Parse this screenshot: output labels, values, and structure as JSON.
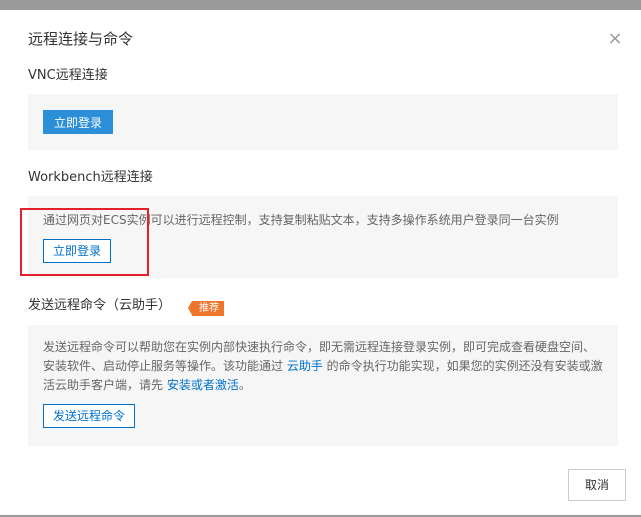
{
  "dialog": {
    "title": "远程连接与命令",
    "close_icon": "×"
  },
  "vnc": {
    "title": "VNC远程连接",
    "button_label": "立即登录"
  },
  "workbench": {
    "title": "Workbench远程连接",
    "description": "通过网页对ECS实例可以进行远程控制，支持复制粘贴文本，支持多操作系统用户登录同一台实例",
    "button_label": "立即登录"
  },
  "command": {
    "title": "发送远程命令（云助手）",
    "badge": "推荐",
    "desc_line1": "发送远程命令可以帮助您在实例内部快速执行命令，即无需远程连接登录实例，即可完成查看硬盘空间、",
    "desc_line2_a": "安装软件、启动停止服务等操作。该功能通过 ",
    "desc_line2_link": "云助手",
    "desc_line2_b": " 的命令执行功能实现，如果您的实例还没有安装或激",
    "desc_line3_a": "活云助手客户端，请先 ",
    "desc_line3_link": "安装或者激活",
    "desc_line3_b": "。",
    "button_label": "发送远程命令"
  },
  "footer": {
    "cancel_label": "取消"
  },
  "colors": {
    "primary": "#2b8ed8",
    "link": "#0070cc",
    "badge": "#f0762d",
    "highlight": "#e5202e"
  }
}
